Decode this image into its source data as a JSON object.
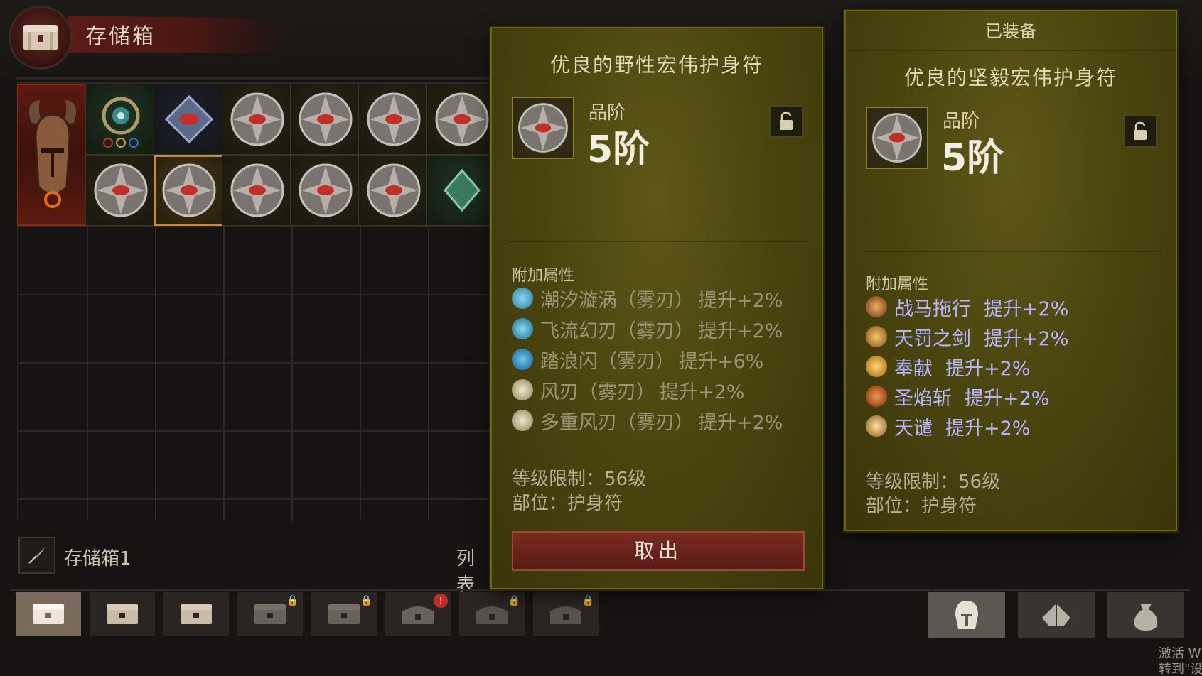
{
  "stash": {
    "title": "存储箱",
    "name": "存储箱1",
    "list_label": "列表"
  },
  "tabs": [
    {
      "icon": "chest-icon",
      "active": true,
      "locked": false
    },
    {
      "icon": "chest-icon",
      "active": false,
      "locked": false
    },
    {
      "icon": "chest-icon",
      "active": false,
      "locked": false
    },
    {
      "icon": "chest-icon",
      "active": false,
      "locked": true
    },
    {
      "icon": "chest-icon",
      "active": false,
      "locked": true
    },
    {
      "icon": "chest-icon",
      "active": false,
      "locked": false,
      "alert": true
    },
    {
      "icon": "chest-icon",
      "active": false,
      "locked": true
    },
    {
      "icon": "chest-icon",
      "active": false,
      "locked": true
    }
  ],
  "right_tabs": [
    {
      "icon": "helmet-icon"
    },
    {
      "icon": "gem-icon"
    },
    {
      "icon": "pouch-icon"
    }
  ],
  "selected_item": {
    "name": "优良的野性宏伟护身符",
    "tier_label": "品阶",
    "tier_value": "5阶",
    "affix_heading": "附加属性",
    "affixes": [
      {
        "name": "潮汐漩涡（雾刃）",
        "bonus": "提升+2%",
        "icon": "tide-icon"
      },
      {
        "name": "飞流幻刃（雾刃）",
        "bonus": "提升+2%",
        "icon": "blade-icon"
      },
      {
        "name": "踏浪闪（雾刃）",
        "bonus": "提升+6%",
        "icon": "wave-icon"
      },
      {
        "name": "风刃（雾刃）",
        "bonus": "提升+2%",
        "icon": "wind-icon"
      },
      {
        "name": "多重风刃（雾刃）",
        "bonus": "提升+2%",
        "icon": "wind-icon"
      }
    ],
    "level_req": "等级限制：56级",
    "slot": "部位：护身符",
    "take_out": "取出"
  },
  "equipped_item": {
    "header": "已装备",
    "name": "优良的坚毅宏伟护身符",
    "tier_label": "品阶",
    "tier_value": "5阶",
    "affix_heading": "附加属性",
    "affixes": [
      {
        "name": "战马拖行",
        "bonus": "提升+2%",
        "icon": "horse-icon"
      },
      {
        "name": "天罚之剑",
        "bonus": "提升+2%",
        "icon": "sword-icon"
      },
      {
        "name": "奉献",
        "bonus": "提升+2%",
        "icon": "consecrate-icon"
      },
      {
        "name": "圣焰斩",
        "bonus": "提升+2%",
        "icon": "flame-slash-icon"
      },
      {
        "name": "天谴",
        "bonus": "提升+2%",
        "icon": "smite-icon"
      }
    ],
    "level_req": "等级限制：56级",
    "slot": "部位：护身符"
  },
  "watermark": "激活 W\n转到\"设置"
}
